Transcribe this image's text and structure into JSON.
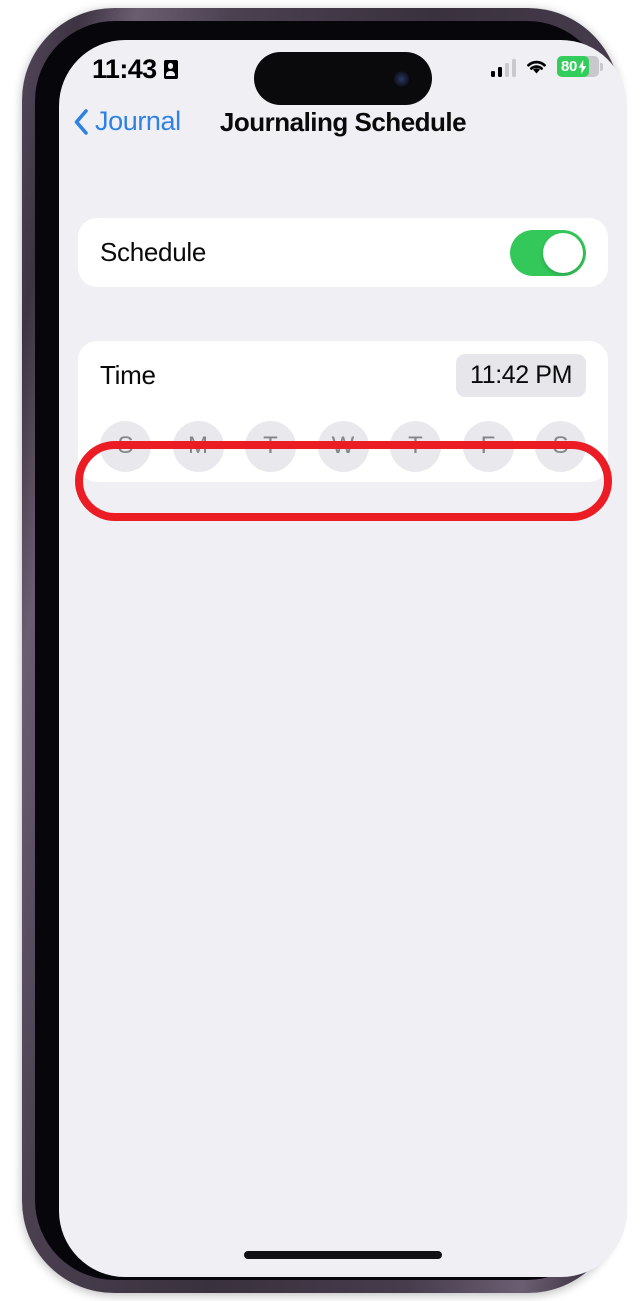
{
  "status_bar": {
    "time": "11:43",
    "focus_icon": "person-badge-icon",
    "signal_icon": "cellular-signal-icon",
    "signal_bars_filled": 2,
    "signal_bars_total": 4,
    "wifi_icon": "wifi-icon",
    "battery_icon": "battery-icon",
    "battery_level": "80",
    "battery_charging": true,
    "battery_color": "#32cd5a"
  },
  "nav_bar": {
    "back_icon": "chevron-left-icon",
    "back_label": "Journal",
    "back_color": "#2e82e4",
    "title": "Journaling Schedule"
  },
  "schedule_section": {
    "label": "Schedule",
    "toggle_name": "schedule-toggle",
    "toggle_on": true,
    "toggle_on_color": "#34c759"
  },
  "time_section": {
    "label": "Time",
    "value": "11:42 PM"
  },
  "days": [
    {
      "letter": "S",
      "name": "sunday",
      "selected": false
    },
    {
      "letter": "M",
      "name": "monday",
      "selected": false
    },
    {
      "letter": "T",
      "name": "tuesday",
      "selected": false
    },
    {
      "letter": "W",
      "name": "wednesday",
      "selected": false
    },
    {
      "letter": "T",
      "name": "thursday",
      "selected": false
    },
    {
      "letter": "F",
      "name": "friday",
      "selected": false
    },
    {
      "letter": "S",
      "name": "saturday",
      "selected": false
    }
  ],
  "annotation": {
    "type": "rounded-rectangle-highlight",
    "color": "#ec1c24",
    "target": "days-selector-row"
  },
  "colors": {
    "page_background": "#f0eff4",
    "card_background": "#ffffff",
    "day_circle_background": "#e8e8ed",
    "day_circle_text": "#85858c",
    "time_pill_background": "#e6e6eb"
  }
}
